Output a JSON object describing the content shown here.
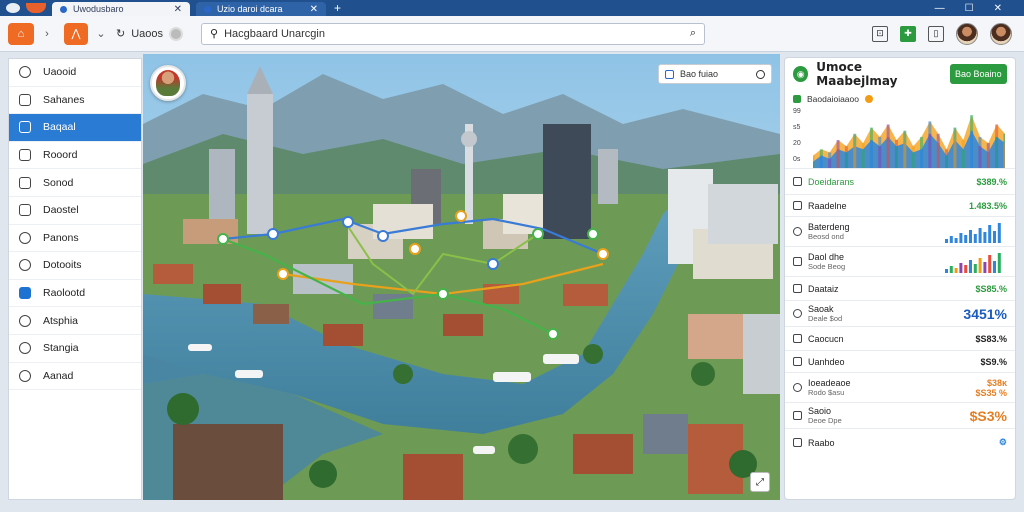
{
  "browser": {
    "tabs": [
      {
        "label": "Uwodusbaro"
      },
      {
        "label": "Uzio daroi dcara"
      }
    ],
    "new_tab": "+",
    "window_controls": [
      "—",
      "☐",
      "✕"
    ]
  },
  "toolbar": {
    "nav_text": "Uaoos",
    "search": {
      "value": "Hacgbaard Unarcgin"
    }
  },
  "sidebar": {
    "items": [
      {
        "label": "Uaooid",
        "icon": "search-icon"
      },
      {
        "label": "Sahanes",
        "icon": "list-icon"
      },
      {
        "label": "Baqaal",
        "icon": "map-icon",
        "active": true
      },
      {
        "label": "Rooord",
        "icon": "file-icon"
      },
      {
        "label": "Sonod",
        "icon": "document-icon"
      },
      {
        "label": "Daostel",
        "icon": "calendar-icon"
      },
      {
        "label": "Panons",
        "icon": "chat-icon"
      },
      {
        "label": "Dotooits",
        "icon": "target-icon"
      },
      {
        "label": "Raolootd",
        "icon": "facebook-icon"
      },
      {
        "label": "Atsphia",
        "icon": "settings-icon"
      },
      {
        "label": "Stangia",
        "icon": "globe-icon"
      },
      {
        "label": "Aanad",
        "icon": "info-icon"
      }
    ]
  },
  "map": {
    "chip_label": "Bao fuiao"
  },
  "panel": {
    "title": "Umoce Maabejlmay",
    "action_label": "Bao Boaino",
    "subheading": "Baodaioiaaoo",
    "y_ticks": [
      "99",
      "s5",
      "20",
      "0s"
    ],
    "chart_data": {
      "type": "area",
      "series": [
        {
          "values": [
            8,
            12,
            10,
            18,
            14,
            22,
            16,
            26,
            20,
            28,
            18,
            24,
            14,
            20,
            30,
            22,
            12,
            26,
            18,
            34,
            20,
            16,
            28,
            22
          ]
        },
        {
          "values": [
            4,
            8,
            6,
            12,
            10,
            14,
            12,
            18,
            14,
            20,
            14,
            16,
            10,
            12,
            22,
            16,
            8,
            18,
            12,
            24,
            14,
            10,
            20,
            16
          ]
        }
      ],
      "colors": [
        "#f39c12",
        "#27ae60",
        "#2e86de",
        "#8e44ad",
        "#e74c3c",
        "#16a085"
      ]
    },
    "rows": [
      {
        "label": "Doeidarans",
        "value": "$389.%",
        "value_color": "green",
        "label_color": "green"
      },
      {
        "label": "Raadelne",
        "value": "1.483.5%",
        "value_color": "green"
      },
      {
        "label": "Baterdeng",
        "sub": "Beosd ond",
        "value": "",
        "spark": "blue"
      },
      {
        "label": "Daol dhe",
        "sub": "Sode Beog",
        "value": "",
        "spark": "multi"
      },
      {
        "label": "Daataiz",
        "value": "$S85.%",
        "value_color": "green"
      },
      {
        "label": "Saoak",
        "sub": "Deale $od",
        "value": "3451%",
        "value_color": "blue"
      },
      {
        "label": "Caocucn",
        "value": "$S83.%"
      },
      {
        "label": "Uanhdeo",
        "value": "$S9.%"
      },
      {
        "label": "Ioeadeaoe",
        "sub": "Rodo $asu",
        "value": "$38ĸ",
        "value2": "$S35 %",
        "value_color": "orange"
      },
      {
        "label": "Saoio",
        "sub": "Deoe Dpe",
        "value": "$S3%",
        "value_color": "orange"
      },
      {
        "label": "Raabo",
        "value": "",
        "trailing_icon": "settings-icon"
      }
    ]
  }
}
